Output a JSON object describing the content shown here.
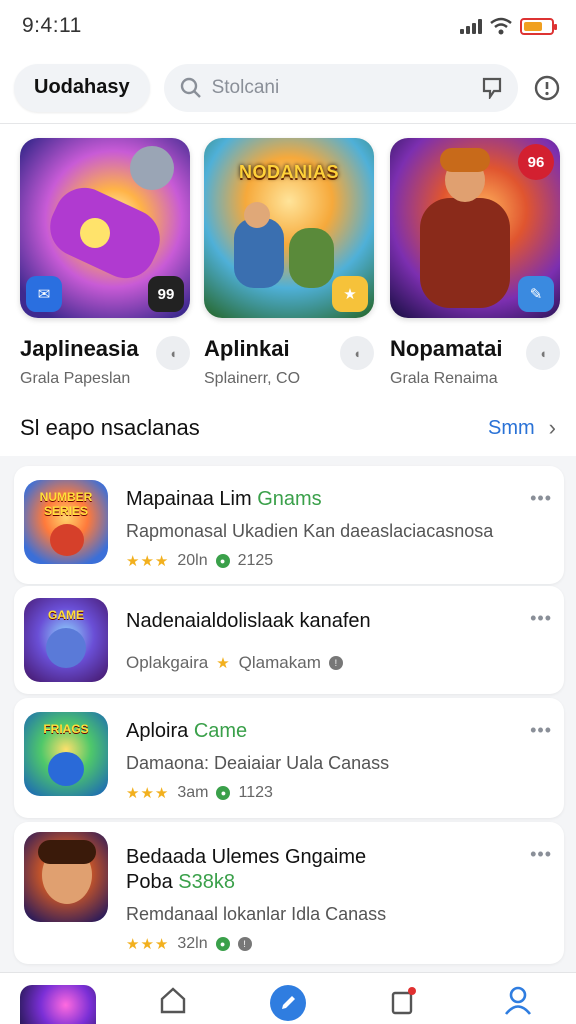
{
  "status": {
    "time": "9:4:11"
  },
  "header": {
    "account_label": "Uodahasy",
    "search_placeholder": "Stolcani"
  },
  "featured": [
    {
      "name": "Japlineasia",
      "sub": "Grala Papeslan",
      "art_title": "",
      "corner": "99"
    },
    {
      "name": "Aplinkai",
      "sub": "Splainerr, CO",
      "art_title": "NODANIAS",
      "corner": ""
    },
    {
      "name": "Nopamatai",
      "sub": "Grala Renaima",
      "art_title": "",
      "corner": "96"
    }
  ],
  "section": {
    "title": "Sl eapo nsaclanas",
    "link": "Smm"
  },
  "list": [
    {
      "title": "Mapainaa Lim ",
      "genre": "Gnams",
      "desc": "Rapmonasal Ukadien Kan daeaslaciacasnosa",
      "rating": 3,
      "count": "20ln",
      "sub": "2125",
      "art_label": "NUMBER SERIES"
    },
    {
      "title": "Nadenaialdolislaak kanafen",
      "genre": "",
      "desc": "",
      "meta": "Oplakgaira ",
      "meta2": "Qlamakam",
      "art_label": "GAME"
    },
    {
      "title": "Aploira ",
      "genre": "Came",
      "desc": "Damaona: Deaiaiar Uala Canass",
      "rating": 3,
      "count": "3am",
      "sub": "1123",
      "art_label": "FRIAGS"
    },
    {
      "title": "Bedaada Ulemes Gngaime",
      "title2": "Poba ",
      "title2_genre": "S38k8",
      "desc": "Remdanaal lokanlar Idla Canass",
      "rating": 3,
      "count": "32ln",
      "sub": "",
      "art_label": ""
    }
  ],
  "colors": {
    "accent": "#2a72d6",
    "genre_green": "#3aa04a",
    "star": "#f2b01e"
  }
}
